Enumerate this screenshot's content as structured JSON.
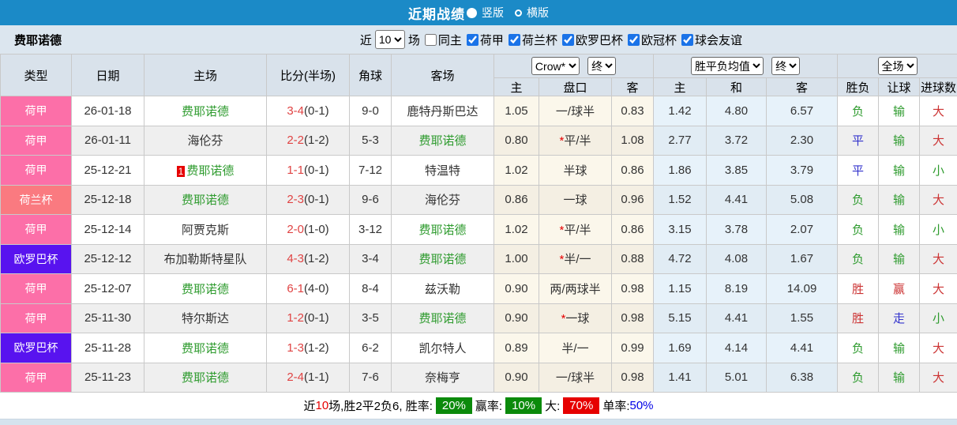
{
  "titlebar": {
    "title": "近期战绩",
    "vertical_label": "竖版",
    "horizontal_label": "横版"
  },
  "filter": {
    "team": "费耶诺德",
    "near_label": "近",
    "count_value": "10",
    "games_label": "场",
    "same_home_label": "同主",
    "leagues": [
      "荷甲",
      "荷兰杯",
      "欧罗巴杯",
      "欧冠杯",
      "球会友谊"
    ]
  },
  "league_colors": {
    "荷甲": "#FC6FA8",
    "荷兰杯": "#FA7A80",
    "欧罗巴杯": "#5813EF"
  },
  "table": {
    "headers": {
      "type": "类型",
      "date": "日期",
      "home": "主场",
      "score": "比分(半场)",
      "corner": "角球",
      "away": "客场",
      "crow_label": "Crow*",
      "crow_final_label": "终",
      "odds_home": "主",
      "odds_handicap": "盘口",
      "odds_away": "客",
      "europe_label": "胜平负均值",
      "europe_final_label": "终",
      "eu_home": "主",
      "eu_draw": "和",
      "eu_away": "客",
      "period_label": "全场",
      "result": "胜负",
      "handicap_result": "让球",
      "goals": "进球数"
    },
    "rows": [
      {
        "league": "荷甲",
        "date": "26-01-18",
        "home": "费耶诺德",
        "home_green": true,
        "home_badge": "",
        "score_ft": "3-4",
        "score_ht": "(0-1)",
        "corner": "9-0",
        "away": "鹿特丹斯巴达",
        "away_green": false,
        "crow_home": "1.05",
        "crow_star": false,
        "crow_handicap": "一/球半",
        "crow_away": "0.83",
        "eu_home": "1.42",
        "eu_draw": "4.80",
        "eu_away": "6.57",
        "result": "负",
        "result_color": "green",
        "handicap_result": "输",
        "handicap_color": "green",
        "goals": "大",
        "goals_color": "red"
      },
      {
        "league": "荷甲",
        "date": "26-01-11",
        "home": "海伦芬",
        "home_green": false,
        "home_badge": "",
        "score_ft": "2-2",
        "score_ht": "(1-2)",
        "corner": "5-3",
        "away": "费耶诺德",
        "away_green": true,
        "crow_home": "0.80",
        "crow_star": true,
        "crow_handicap": "平/半",
        "crow_away": "1.08",
        "eu_home": "2.77",
        "eu_draw": "3.72",
        "eu_away": "2.30",
        "result": "平",
        "result_color": "blue",
        "handicap_result": "输",
        "handicap_color": "green",
        "goals": "大",
        "goals_color": "red"
      },
      {
        "league": "荷甲",
        "date": "25-12-21",
        "home": "费耶诺德",
        "home_green": true,
        "home_badge": "1",
        "score_ft": "1-1",
        "score_ht": "(0-1)",
        "corner": "7-12",
        "away": "特温特",
        "away_green": false,
        "crow_home": "1.02",
        "crow_star": false,
        "crow_handicap": "半球",
        "crow_away": "0.86",
        "eu_home": "1.86",
        "eu_draw": "3.85",
        "eu_away": "3.79",
        "result": "平",
        "result_color": "blue",
        "handicap_result": "输",
        "handicap_color": "green",
        "goals": "小",
        "goals_color": "green"
      },
      {
        "league": "荷兰杯",
        "date": "25-12-18",
        "home": "费耶诺德",
        "home_green": true,
        "home_badge": "",
        "score_ft": "2-3",
        "score_ht": "(0-1)",
        "corner": "9-6",
        "away": "海伦芬",
        "away_green": false,
        "crow_home": "0.86",
        "crow_star": false,
        "crow_handicap": "一球",
        "crow_away": "0.96",
        "eu_home": "1.52",
        "eu_draw": "4.41",
        "eu_away": "5.08",
        "result": "负",
        "result_color": "green",
        "handicap_result": "输",
        "handicap_color": "green",
        "goals": "大",
        "goals_color": "red"
      },
      {
        "league": "荷甲",
        "date": "25-12-14",
        "home": "阿贾克斯",
        "home_green": false,
        "home_badge": "",
        "score_ft": "2-0",
        "score_ht": "(1-0)",
        "corner": "3-12",
        "away": "费耶诺德",
        "away_green": true,
        "crow_home": "1.02",
        "crow_star": true,
        "crow_handicap": "平/半",
        "crow_away": "0.86",
        "eu_home": "3.15",
        "eu_draw": "3.78",
        "eu_away": "2.07",
        "result": "负",
        "result_color": "green",
        "handicap_result": "输",
        "handicap_color": "green",
        "goals": "小",
        "goals_color": "green"
      },
      {
        "league": "欧罗巴杯",
        "date": "25-12-12",
        "home": "布加勒斯特星队",
        "home_green": false,
        "home_badge": "",
        "score_ft": "4-3",
        "score_ht": "(1-2)",
        "corner": "3-4",
        "away": "费耶诺德",
        "away_green": true,
        "crow_home": "1.00",
        "crow_star": true,
        "crow_handicap": "半/一",
        "crow_away": "0.88",
        "eu_home": "4.72",
        "eu_draw": "4.08",
        "eu_away": "1.67",
        "result": "负",
        "result_color": "green",
        "handicap_result": "输",
        "handicap_color": "green",
        "goals": "大",
        "goals_color": "red"
      },
      {
        "league": "荷甲",
        "date": "25-12-07",
        "home": "费耶诺德",
        "home_green": true,
        "home_badge": "",
        "score_ft": "6-1",
        "score_ht": "(4-0)",
        "corner": "8-4",
        "away": "兹沃勒",
        "away_green": false,
        "crow_home": "0.90",
        "crow_star": false,
        "crow_handicap": "两/两球半",
        "crow_away": "0.98",
        "eu_home": "1.15",
        "eu_draw": "8.19",
        "eu_away": "14.09",
        "result": "胜",
        "result_color": "red",
        "handicap_result": "赢",
        "handicap_color": "red",
        "goals": "大",
        "goals_color": "red"
      },
      {
        "league": "荷甲",
        "date": "25-11-30",
        "home": "特尔斯达",
        "home_green": false,
        "home_badge": "",
        "score_ft": "1-2",
        "score_ht": "(0-1)",
        "corner": "3-5",
        "away": "费耶诺德",
        "away_green": true,
        "crow_home": "0.90",
        "crow_star": true,
        "crow_handicap": "一球",
        "crow_away": "0.98",
        "eu_home": "5.15",
        "eu_draw": "4.41",
        "eu_away": "1.55",
        "result": "胜",
        "result_color": "red",
        "handicap_result": "走",
        "handicap_color": "blue",
        "goals": "小",
        "goals_color": "green"
      },
      {
        "league": "欧罗巴杯",
        "date": "25-11-28",
        "home": "费耶诺德",
        "home_green": true,
        "home_badge": "",
        "score_ft": "1-3",
        "score_ht": "(1-2)",
        "corner": "6-2",
        "away": "凯尔特人",
        "away_green": false,
        "crow_home": "0.89",
        "crow_star": false,
        "crow_handicap": "半/一",
        "crow_away": "0.99",
        "eu_home": "1.69",
        "eu_draw": "4.14",
        "eu_away": "4.41",
        "result": "负",
        "result_color": "green",
        "handicap_result": "输",
        "handicap_color": "green",
        "goals": "大",
        "goals_color": "red"
      },
      {
        "league": "荷甲",
        "date": "25-11-23",
        "home": "费耶诺德",
        "home_green": true,
        "home_badge": "",
        "score_ft": "2-4",
        "score_ht": "(1-1)",
        "corner": "7-6",
        "away": "奈梅亨",
        "away_green": false,
        "crow_home": "0.90",
        "crow_star": false,
        "crow_handicap": "一/球半",
        "crow_away": "0.98",
        "eu_home": "1.41",
        "eu_draw": "5.01",
        "eu_away": "6.38",
        "result": "负",
        "result_color": "green",
        "handicap_result": "输",
        "handicap_color": "green",
        "goals": "大",
        "goals_color": "red"
      }
    ]
  },
  "summary": {
    "prefix": "近",
    "count": "10",
    "record_text": "场,胜2平2负6, 胜率:",
    "win_rate": "20%",
    "win_odds_label": "赢率:",
    "win_odds_rate": "10%",
    "big_label": "大:",
    "big_rate": "70%",
    "single_label": "单率:",
    "single_rate": "50%"
  }
}
